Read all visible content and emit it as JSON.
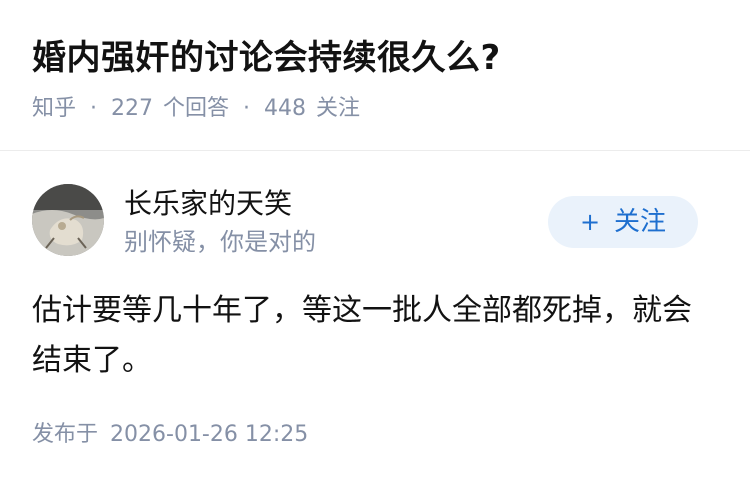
{
  "question": {
    "title": "婚内强奸的讨论会持续很久么?",
    "source": "知乎",
    "answer_count": "227",
    "answer_label": "个回答",
    "follower_count": "448",
    "follower_label": "关注"
  },
  "answer": {
    "author_name": "长乐家的天笑",
    "author_bio": "别怀疑，你是对的",
    "follow_button_label": "关注",
    "follow_button_icon": "+",
    "content": "估计要等几十年了，等这一批人全部都死掉，就会结束了。",
    "time_prefix": "发布于",
    "time": "2026-01-26 12:25"
  },
  "colors": {
    "title": "#121212",
    "meta": "#8590a6",
    "follow_bg": "#eaf2fb",
    "follow_text": "#1e6fcf"
  }
}
